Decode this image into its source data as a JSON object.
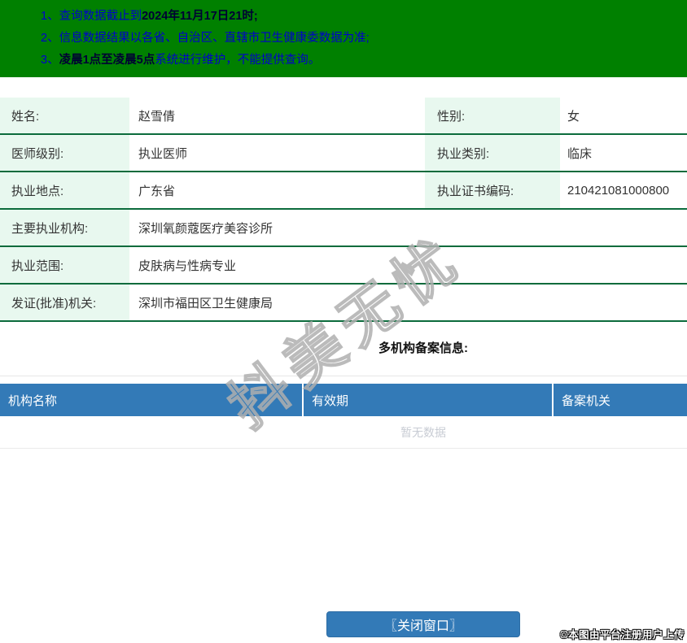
{
  "colors": {
    "header_green": "#008000",
    "notice_text_blue": "#0000cc",
    "notice_bold_dark": "#000033",
    "table_line_green": "#0c6b3c",
    "label_cell_mint": "#e8f8ef",
    "record_header_blue": "#337ab7",
    "button_blue": "#337ab7",
    "no_data_gray": "#c8ccd4"
  },
  "notices": [
    {
      "num": "1、",
      "pre": "查询数据截止到",
      "bold": "2024年11月17日21时;",
      "post": ""
    },
    {
      "num": "2、",
      "pre": "信息数据结果以各省、自治区、直辖市卫生健康委数据为准;",
      "bold": "",
      "post": ""
    },
    {
      "num": "3、",
      "pre": "",
      "bold": "凌晨1点至凌晨5点",
      "post": "系统进行维护，不能提供查询。"
    }
  ],
  "doctor_info": {
    "rows": [
      {
        "label1": "姓名:",
        "value1": "赵雪倩",
        "label2": "性别:",
        "value2": "女"
      },
      {
        "label1": "医师级别:",
        "value1": "执业医师",
        "label2": "执业类别:",
        "value2": "临床"
      },
      {
        "label1": "执业地点:",
        "value1": "广东省",
        "label2": "执业证书编码:",
        "value2": "210421081000800"
      },
      {
        "label1": "主要执业机构:",
        "value1": "深圳氧颜蔻医疗美容诊所"
      },
      {
        "label1": "执业范围:",
        "value1": "皮肤病与性病专业"
      },
      {
        "label1": "发证(批准)机关:",
        "value1": "深圳市福田区卫生健康局"
      }
    ]
  },
  "multi_org_section": {
    "title": "多机构备案信息:",
    "columns": [
      "机构名称",
      "有效期",
      "备案机关"
    ],
    "empty_text": "暂无数据"
  },
  "close_button_label": "〖关闭窗口〗",
  "watermark_text": "抖美无忧",
  "copyright_text": "©本图由平台注册用户上传"
}
